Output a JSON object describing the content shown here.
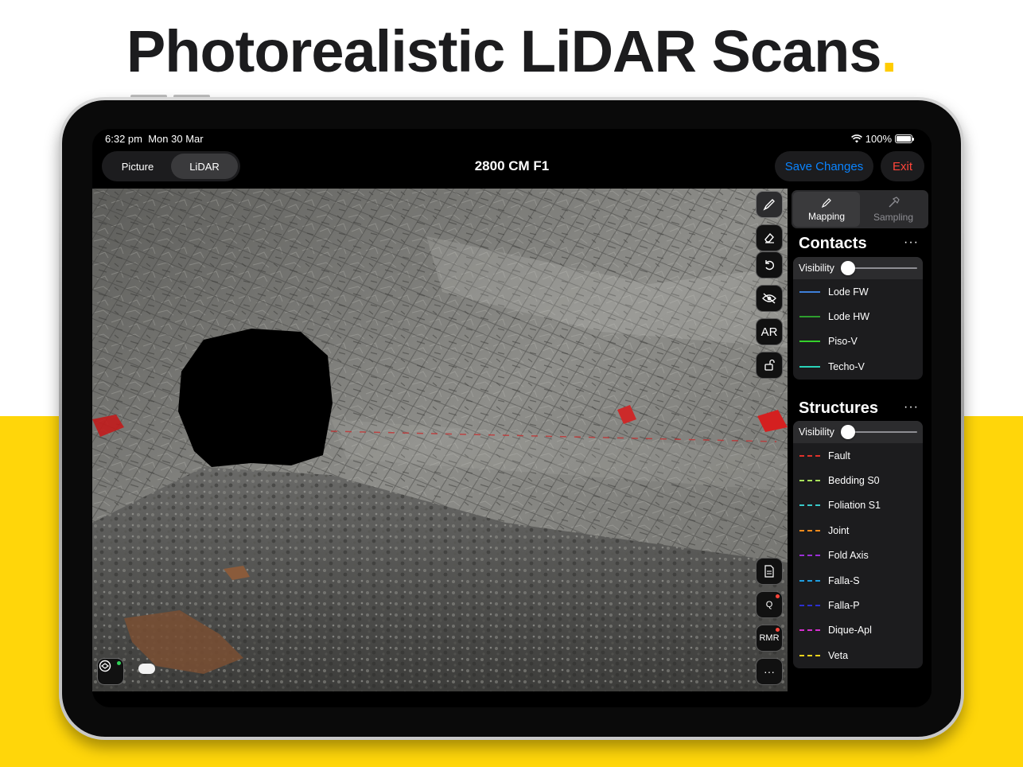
{
  "headline": {
    "text": "Photorealistic LiDAR Scans",
    "dot": "."
  },
  "status_bar": {
    "time": "6:32 pm",
    "date": "Mon 30 Mar",
    "battery": "100%"
  },
  "nav": {
    "segments": [
      {
        "label": "Picture",
        "active": false
      },
      {
        "label": "LiDAR",
        "active": true
      }
    ],
    "title": "2800 CM F1",
    "save_label": "Save Changes",
    "exit_label": "Exit"
  },
  "toolbar": {
    "tools_top": [
      {
        "name": "draw-tool",
        "icon": "pen-icon",
        "active": true
      },
      {
        "name": "eraser-tool",
        "icon": "eraser-icon"
      },
      {
        "name": "undo-tool",
        "icon": "undo-icon"
      },
      {
        "name": "visibility-tool",
        "icon": "eye-slash-icon"
      },
      {
        "name": "ar-tool",
        "label": "AR"
      },
      {
        "name": "lock-tool",
        "icon": "unlock-icon"
      }
    ],
    "tools_bottom": [
      {
        "name": "notes-tool",
        "icon": "document-icon"
      },
      {
        "name": "q-tool",
        "label": "Q",
        "badge": true
      },
      {
        "name": "rmr-tool",
        "label": "RMR",
        "badge": true
      },
      {
        "name": "more-tool",
        "label": "···"
      }
    ]
  },
  "mode_tabs": [
    {
      "label": "Mapping",
      "icon": "pen-icon",
      "active": true
    },
    {
      "label": "Sampling",
      "icon": "hammer-icon",
      "active": false
    }
  ],
  "contacts": {
    "title": "Contacts",
    "more": "···",
    "visibility_label": "Visibility",
    "visibility_value": 0,
    "items": [
      {
        "label": "Lode FW",
        "color": "#3d7fd9",
        "style": "solid"
      },
      {
        "label": "Lode HW",
        "color": "#2e9e2e",
        "style": "solid"
      },
      {
        "label": "Piso-V",
        "color": "#34d12b",
        "style": "solid"
      },
      {
        "label": "Techo-V",
        "color": "#2ad3b8",
        "style": "solid"
      }
    ]
  },
  "structures": {
    "title": "Structures",
    "more": "···",
    "visibility_label": "Visibility",
    "visibility_value": 0,
    "items": [
      {
        "label": "Fault",
        "color": "#e0312b",
        "style": "dashed"
      },
      {
        "label": "Bedding S0",
        "color": "#a8e05a",
        "style": "dashed"
      },
      {
        "label": "Foliation S1",
        "color": "#39c9c9",
        "style": "dashed"
      },
      {
        "label": "Joint",
        "color": "#f08a1c",
        "style": "dashed"
      },
      {
        "label": "Fold Axis",
        "color": "#9b2fd6",
        "style": "dashed"
      },
      {
        "label": "Falla-S",
        "color": "#1f9de0",
        "style": "dashed"
      },
      {
        "label": "Falla-P",
        "color": "#2c2fd0",
        "style": "dashed"
      },
      {
        "label": "Dique-Apl",
        "color": "#d62fcf",
        "style": "dashed"
      },
      {
        "label": "Veta",
        "color": "#f0d21c",
        "style": "dashed"
      }
    ]
  },
  "colors": {
    "accent_blue": "#0a84ff",
    "exit_red": "#ff453a",
    "brand_yellow": "#ffd60a"
  }
}
